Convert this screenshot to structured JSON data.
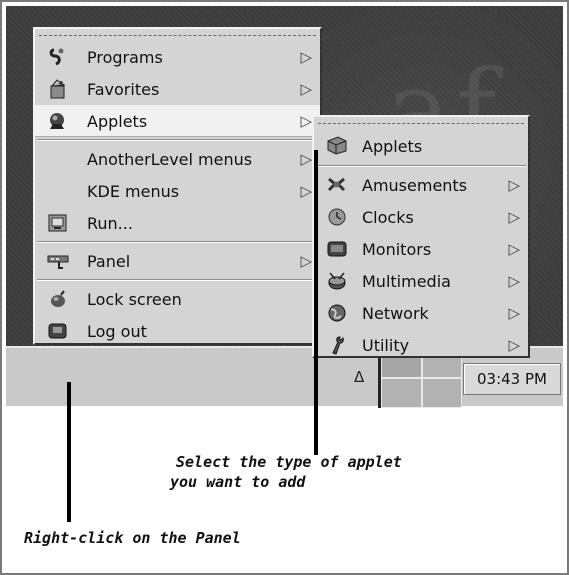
{
  "main_menu": {
    "items": [
      {
        "label": "Programs",
        "icon": "programs-icon",
        "has_submenu": true
      },
      {
        "label": "Favorites",
        "icon": "favorites-icon",
        "has_submenu": true
      },
      {
        "label": "Applets",
        "icon": "applets-icon",
        "has_submenu": true,
        "selected": true
      },
      {
        "label": "AnotherLevel menus",
        "icon": "",
        "has_submenu": true
      },
      {
        "label": "KDE menus",
        "icon": "",
        "has_submenu": true
      },
      {
        "label": "Run...",
        "icon": "run-icon",
        "has_submenu": false
      },
      {
        "label": "Panel",
        "icon": "panel-icon",
        "has_submenu": true
      },
      {
        "label": "Lock screen",
        "icon": "lock-icon",
        "has_submenu": false
      },
      {
        "label": "Log out",
        "icon": "logout-icon",
        "has_submenu": false
      }
    ]
  },
  "applets_menu": {
    "title": "Applets",
    "items": [
      {
        "label": "Amusements",
        "icon": "amusements-icon"
      },
      {
        "label": "Clocks",
        "icon": "clock-icon"
      },
      {
        "label": "Monitors",
        "icon": "monitor-icon"
      },
      {
        "label": "Multimedia",
        "icon": "multimedia-icon"
      },
      {
        "label": "Network",
        "icon": "network-icon"
      },
      {
        "label": "Utility",
        "icon": "utility-icon"
      }
    ]
  },
  "panel": {
    "hide_arrow": "Δ",
    "clock": "03:43 PM"
  },
  "annotations": {
    "applet_type_line1": "Select the type of applet",
    "applet_type_line2": "you want to add",
    "right_click": "Right-click on the Panel"
  },
  "glyphs": {
    "submenu_arrow": "▷"
  }
}
